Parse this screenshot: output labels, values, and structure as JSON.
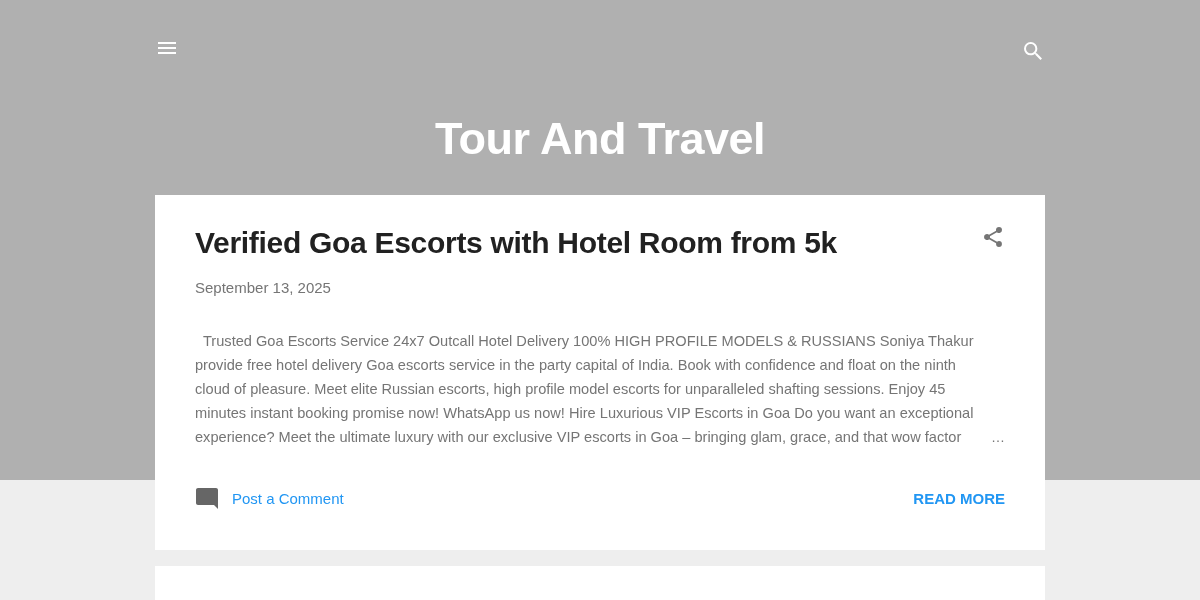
{
  "header": {
    "title": "Tour And Travel"
  },
  "posts": [
    {
      "title": "Verified Goa Escorts with Hotel Room from 5k",
      "date": "September 13, 2025",
      "snippet": "Trusted Goa Escorts Service 24x7 Outcall Hotel Delivery 100% HIGH PROFILE MODELS & RUSSIANS Soniya Thakur provide free hotel delivery Goa escorts service in the party capital of India. Book with confidence and float on the ninth cloud of pleasure. Meet elite Russian escorts, high profile model escorts for unparalleled shafting sessions. Enjoy 45 minutes instant booking promise now! WhatsApp us now! Hire Luxurious VIP Escorts in Goa Do you want an exceptional experience? Meet the ultimate luxury with our exclusive VIP escorts in Goa – bringing glam, grace, and that wow factor",
      "ellipsis": "…",
      "comment_link": "Post a Comment",
      "read_more": "READ MORE"
    }
  ]
}
